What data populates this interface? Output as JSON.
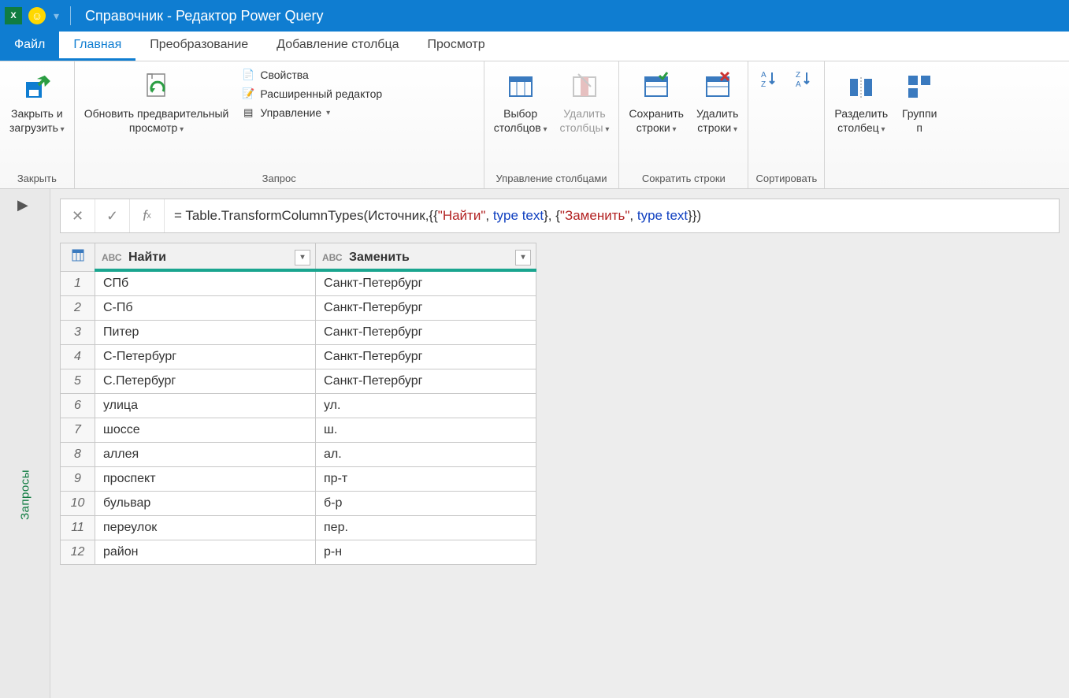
{
  "titlebar": {
    "title": "Справочник - Редактор Power Query"
  },
  "tabs": {
    "file": "Файл",
    "home": "Главная",
    "transform": "Преобразование",
    "addcolumn": "Добавление столбца",
    "view": "Просмотр"
  },
  "ribbon": {
    "close_group": {
      "label": "Закрыть",
      "close_load": "Закрыть и\nзагрузить"
    },
    "query_group": {
      "label": "Запрос",
      "refresh_preview": "Обновить предварительный\nпросмотр",
      "properties": "Свойства",
      "advanced_editor": "Расширенный редактор",
      "manage": "Управление"
    },
    "columns_group": {
      "label": "Управление столбцами",
      "choose_columns": "Выбор\nстолбцов",
      "remove_columns": "Удалить\nстолбцы"
    },
    "rows_group": {
      "label": "Сократить строки",
      "keep_rows": "Сохранить\nстроки",
      "remove_rows": "Удалить\nстроки"
    },
    "sort_group": {
      "label": "Сортировать"
    },
    "split_group": {
      "split_column": "Разделить\nстолбец",
      "group_by": "Группи\nп"
    }
  },
  "sidebar": {
    "label": "Запросы"
  },
  "formula": {
    "prefix": "= Table.TransformColumnTypes(Источник,{{",
    "s1": "\"Найти\"",
    "mid1": ", ",
    "t1": "type",
    "sp1": " ",
    "t1b": "text",
    "mid2": "}, {",
    "s2": "\"Заменить\"",
    "mid3": ", ",
    "t2": "type",
    "sp2": " ",
    "t2b": "text",
    "suffix": "}})"
  },
  "table": {
    "col1_type": "AВС",
    "col1_name": "Найти",
    "col2_type": "AВС",
    "col2_name": "Заменить",
    "rows": [
      {
        "n": "1",
        "find": "СПб",
        "replace": "Санкт-Петербург"
      },
      {
        "n": "2",
        "find": "С-Пб",
        "replace": "Санкт-Петербург"
      },
      {
        "n": "3",
        "find": "Питер",
        "replace": "Санкт-Петербург"
      },
      {
        "n": "4",
        "find": "С-Петербург",
        "replace": "Санкт-Петербург"
      },
      {
        "n": "5",
        "find": "С.Петербург",
        "replace": "Санкт-Петербург"
      },
      {
        "n": "6",
        "find": "улица",
        "replace": "ул."
      },
      {
        "n": "7",
        "find": "шоссе",
        "replace": "ш."
      },
      {
        "n": "8",
        "find": "аллея",
        "replace": "ал."
      },
      {
        "n": "9",
        "find": "проспект",
        "replace": "пр-т"
      },
      {
        "n": "10",
        "find": "бульвар",
        "replace": "б-р"
      },
      {
        "n": "11",
        "find": "переулок",
        "replace": "пер."
      },
      {
        "n": "12",
        "find": "район",
        "replace": "р-н"
      }
    ]
  }
}
